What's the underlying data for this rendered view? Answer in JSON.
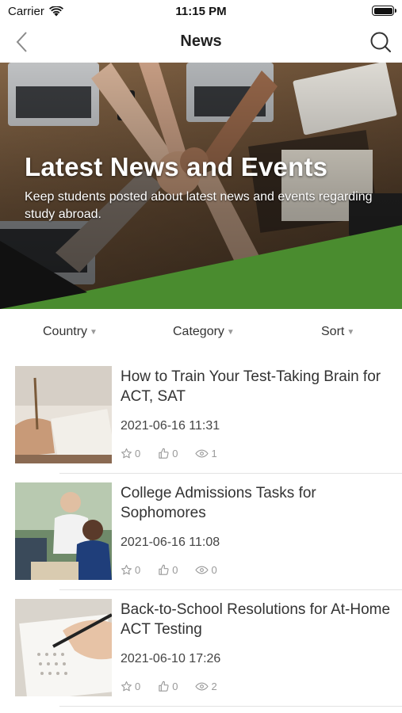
{
  "status_bar": {
    "carrier": "Carrier",
    "time": "11:15 PM",
    "icons": [
      "wifi-icon",
      "battery-icon"
    ]
  },
  "nav": {
    "title": "News",
    "back_icon": "chevron-left-icon",
    "search_icon": "search-icon"
  },
  "hero": {
    "title": "Latest News and Events",
    "subtitle": "Keep students posted about latest news and events regarding study abroad.",
    "accent_color": "#4a8c2f"
  },
  "filters": [
    {
      "label": "Country"
    },
    {
      "label": "Category"
    },
    {
      "label": "Sort"
    }
  ],
  "news": [
    {
      "title": "How to Train Your Test-Taking Brain for ACT, SAT",
      "date": "2021-06-16 11:31",
      "favorites": "0",
      "likes": "0",
      "views": "1",
      "thumb_icon": "student-writing-photo"
    },
    {
      "title": "College Admissions Tasks for Sophomores",
      "date": "2021-06-16 11:08",
      "favorites": "0",
      "likes": "0",
      "views": "0",
      "thumb_icon": "teacher-student-photo"
    },
    {
      "title": "Back-to-School Resolutions for At-Home ACT Testing",
      "date": "2021-06-10 17:26",
      "favorites": "0",
      "likes": "0",
      "views": "2",
      "thumb_icon": "answer-sheet-photo"
    }
  ]
}
